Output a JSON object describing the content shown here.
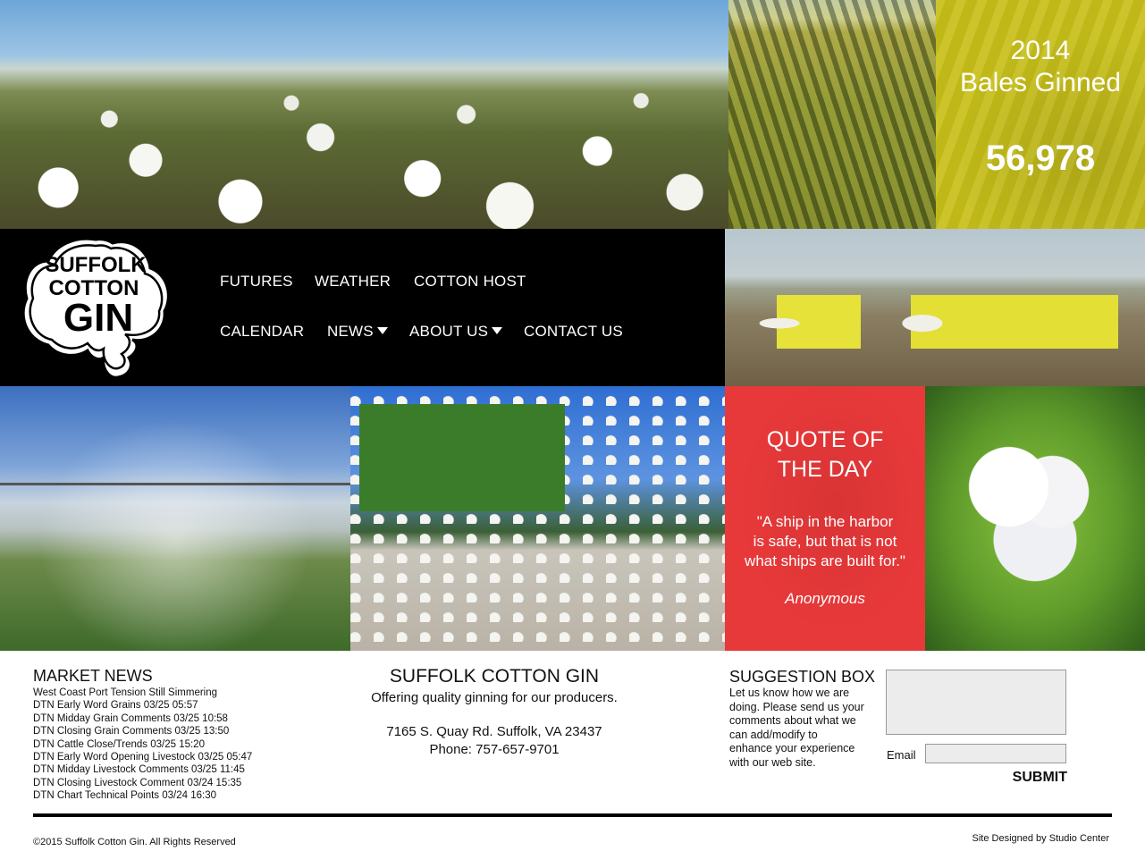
{
  "colors": {
    "accent_yellow": "#c8c01a",
    "quote_red": "#e8393a",
    "nav_background": "#000000",
    "text_white": "#ffffff"
  },
  "stats": {
    "year": "2014",
    "label": "Bales Ginned",
    "count": "56,978"
  },
  "logo": {
    "line1": "SUFFOLK",
    "line2": "COTTON",
    "line3": "GIN"
  },
  "nav": {
    "items": [
      {
        "label": "FUTURES"
      },
      {
        "label": "WEATHER"
      },
      {
        "label": "COTTON HOST"
      },
      {
        "label": "CALENDAR"
      },
      {
        "label": "NEWS",
        "icon": "caret-down-icon"
      },
      {
        "label": "ABOUT US",
        "icon": "caret-down-icon"
      },
      {
        "label": "CONTACT US"
      }
    ]
  },
  "quote": {
    "title_line1": "QUOTE OF",
    "title_line2": "THE DAY",
    "line1": "\"A ship in the harbor",
    "line2": "is safe, but that is not",
    "line3": "what ships are built for.\"",
    "author": "Anonymous"
  },
  "market_news": {
    "heading": "MARKET NEWS",
    "items": [
      "West Coast Port Tension Still Simmering",
      "DTN Early Word Grains 03/25 05:57",
      "DTN Midday Grain Comments 03/25 10:58",
      "DTN Closing Grain Comments 03/25 13:50",
      "DTN Cattle Close/Trends 03/25 15:20",
      "DTN Early Word Opening Livestock 03/25 05:47",
      "DTN Midday Livestock Comments 03/25 11:45",
      "DTN Closing Livestock Comment 03/24 15:35",
      "DTN Chart Technical Points 03/24 16:30"
    ]
  },
  "contact": {
    "title": "SUFFOLK COTTON GIN",
    "tagline": "Offering quality ginning for our producers.",
    "address": "7165 S. Quay Rd. Suffolk, VA 23437",
    "phone": "Phone: 757-657-9701"
  },
  "suggestion": {
    "heading": "SUGGESTION BOX",
    "line1": "Let us know how we are",
    "line2": "doing. Please send us your",
    "line3": "comments about what we",
    "line4": "can add/modify to",
    "line5": "enhance your experience",
    "line6": "with our web site.",
    "message_value": "",
    "email_label": "Email",
    "email_value": "",
    "submit_label": "SUBMIT"
  },
  "footer": {
    "copyright": "©2015 Suffolk Cotton Gin. All Rights Reserved",
    "credit": "Site Designed by Studio Center"
  }
}
